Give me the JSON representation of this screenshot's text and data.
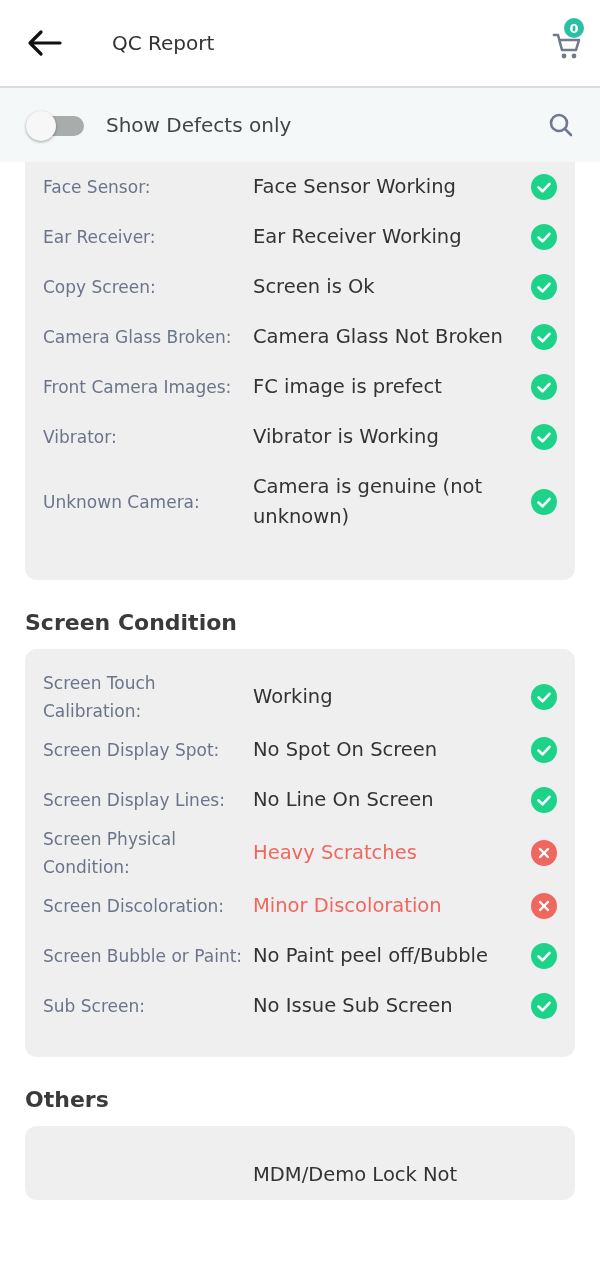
{
  "header": {
    "title": "QC Report",
    "cart_badge": "0"
  },
  "filter": {
    "label": "Show Defects only",
    "on": false
  },
  "sections": [
    {
      "rows": [
        {
          "label": "Face Sensor:",
          "value": "Face Sensor Working",
          "ok": true
        },
        {
          "label": "Ear Receiver:",
          "value": "Ear Receiver Working",
          "ok": true
        },
        {
          "label": "Copy Screen:",
          "value": "Screen is Ok",
          "ok": true
        },
        {
          "label": "Camera Glass Broken:",
          "value": "Camera Glass Not Broken",
          "ok": true
        },
        {
          "label": "Front Camera Images:",
          "value": "FC image is prefect",
          "ok": true
        },
        {
          "label": "Vibrator:",
          "value": "Vibrator is Working",
          "ok": true
        },
        {
          "label": "Unknown Camera:",
          "value": "Camera is genuine (not unknown)",
          "ok": true
        }
      ]
    },
    {
      "title": "Screen Condition",
      "rows": [
        {
          "label": "Screen Touch Calibration:",
          "value": "Working",
          "ok": true
        },
        {
          "label": "Screen Display Spot:",
          "value": "No Spot On Screen",
          "ok": true
        },
        {
          "label": "Screen Display Lines:",
          "value": "No Line On Screen",
          "ok": true
        },
        {
          "label": "Screen Physical Condition:",
          "value": "Heavy Scratches",
          "ok": false
        },
        {
          "label": "Screen Discoloration:",
          "value": "Minor Discoloration",
          "ok": false
        },
        {
          "label": "Screen Bubble or Paint:",
          "value": "No Paint peel off/Bubble",
          "ok": true
        },
        {
          "label": "Sub Screen:",
          "value": "No Issue Sub Screen",
          "ok": true
        }
      ]
    },
    {
      "title": "Others",
      "rows": [
        {
          "value": "MDM/Demo Lock Not"
        }
      ]
    }
  ]
}
